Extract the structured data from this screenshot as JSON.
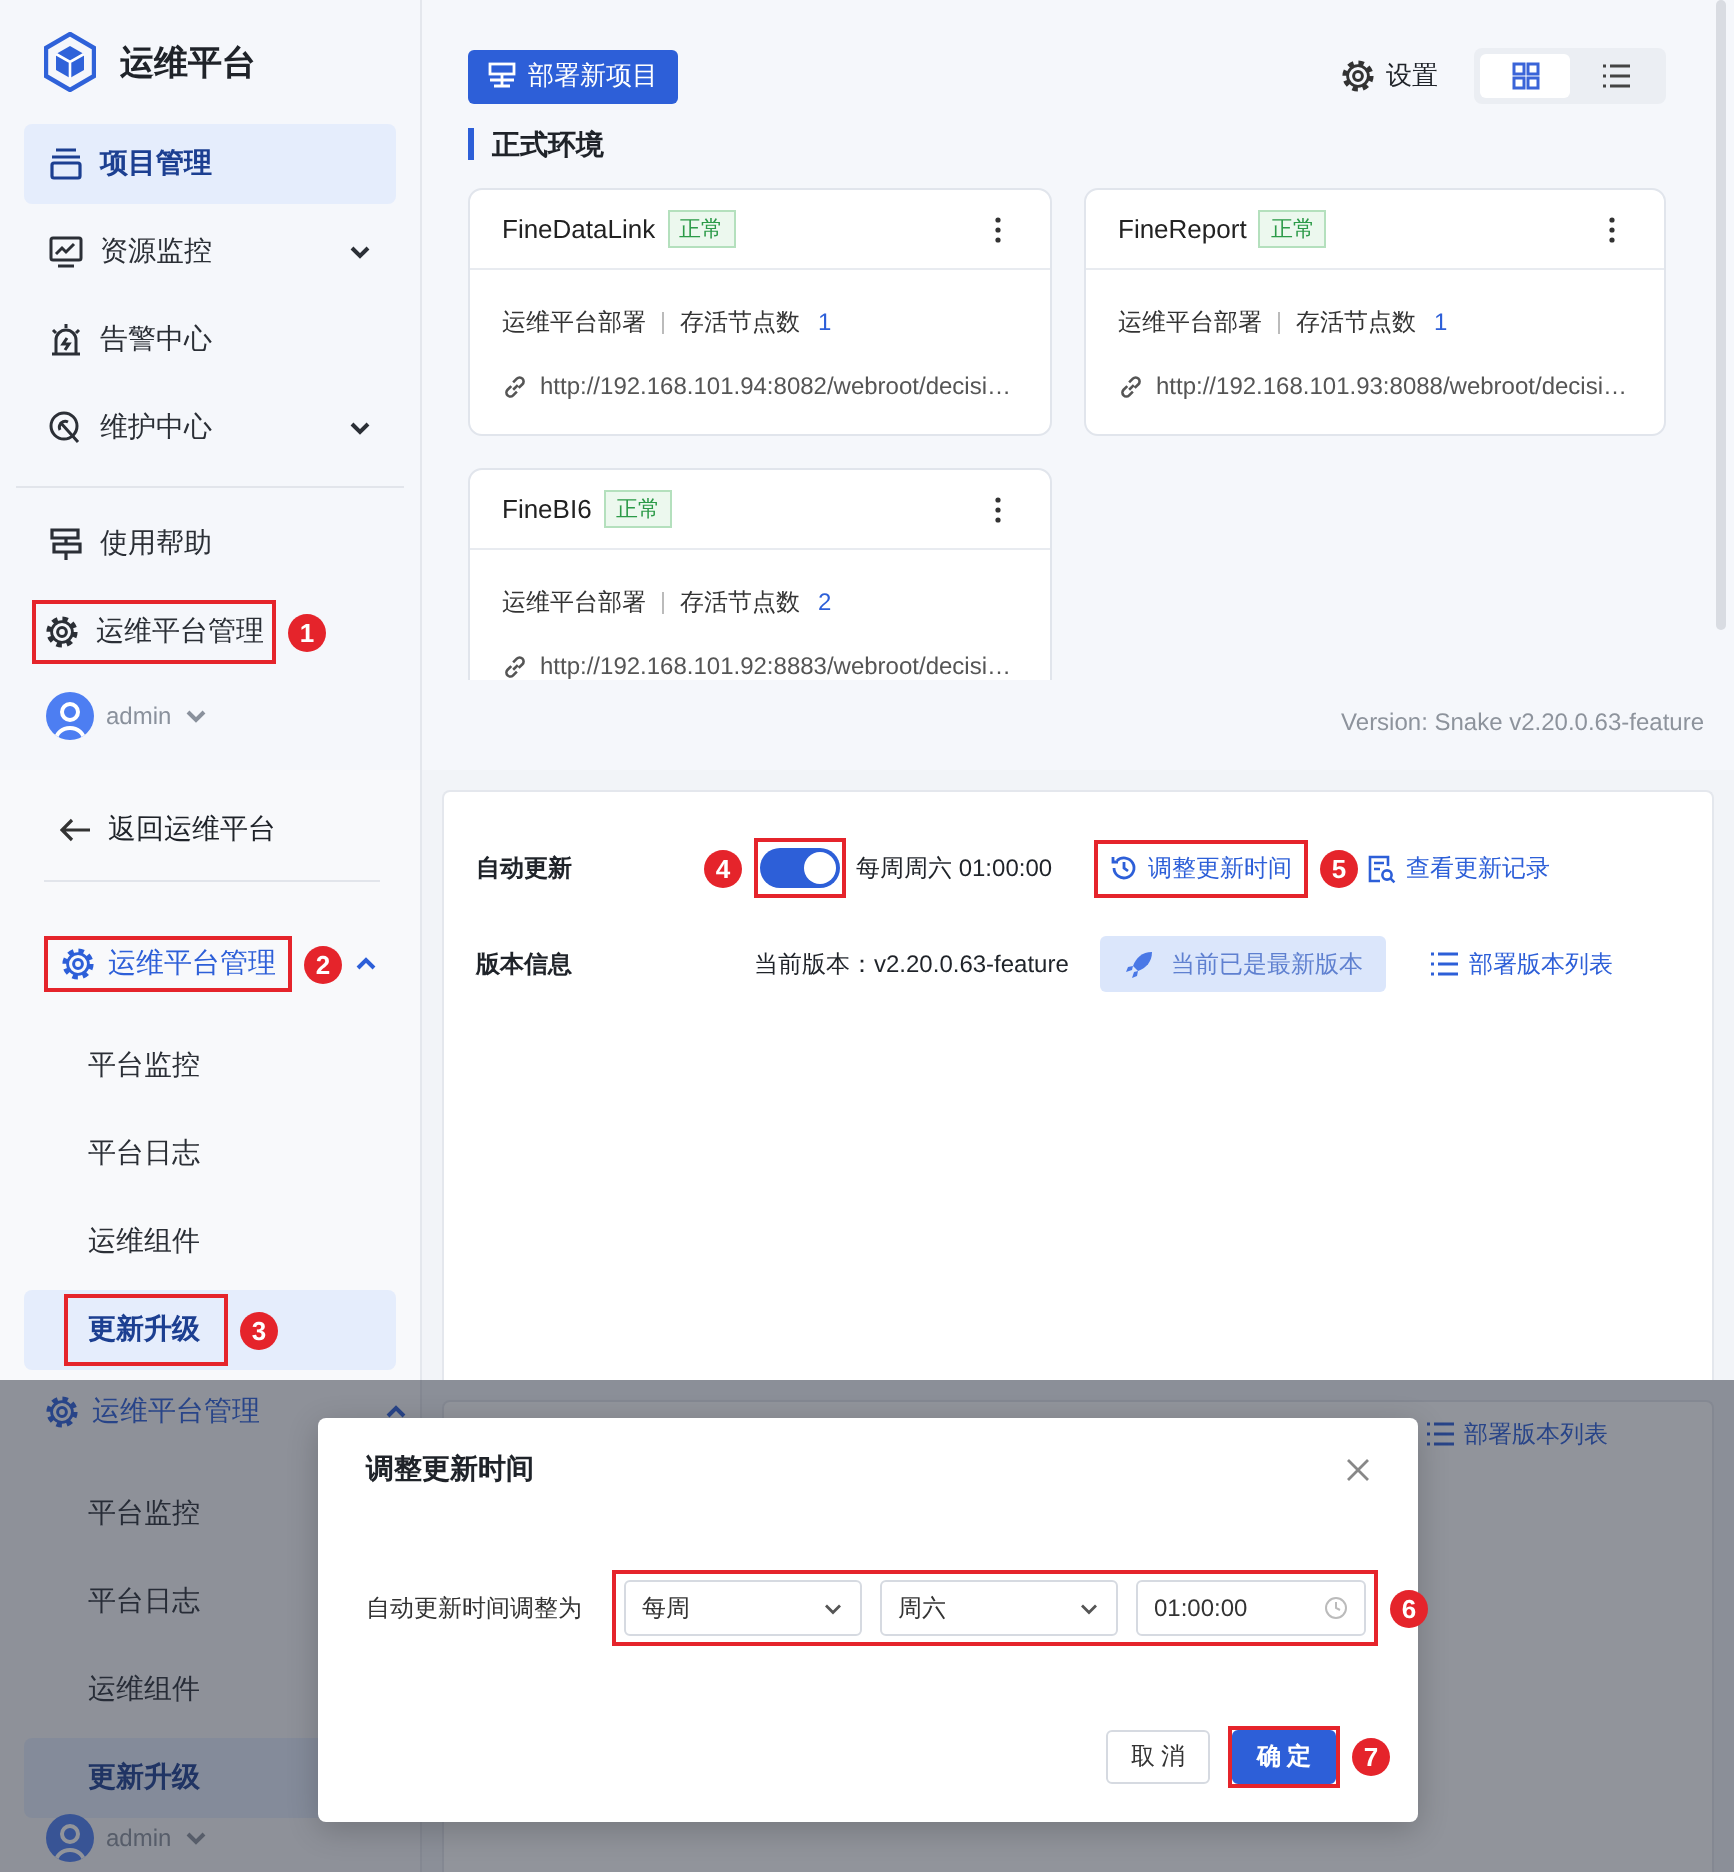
{
  "projects_view": {
    "app_title": "运维平台",
    "nav": [
      {
        "label": "项目管理",
        "selected": true,
        "expandable": false
      },
      {
        "label": "资源监控",
        "selected": false,
        "expandable": true
      },
      {
        "label": "告警中心",
        "selected": false,
        "expandable": false
      },
      {
        "label": "维护中心",
        "selected": false,
        "expandable": true
      }
    ],
    "bottom_nav": [
      {
        "label": "使用帮助",
        "selected": false
      },
      {
        "label": "运维平台管理",
        "selected": false,
        "callout": "1"
      }
    ],
    "user": "admin",
    "deploy_button": "部署新项目",
    "settings_label": "设置",
    "views": [
      {
        "kind": "grid",
        "selected": true
      },
      {
        "kind": "list",
        "selected": false
      }
    ],
    "section_title": "正式环境",
    "cards": [
      {
        "name": "FineDataLink",
        "status": "正常",
        "deploy": "运维平台部署",
        "nodes_label": "存活节点数",
        "nodes": "1",
        "url": "http://192.168.101.94:8082/webroot/decisi…"
      },
      {
        "name": "FineReport",
        "status": "正常",
        "deploy": "运维平台部署",
        "nodes_label": "存活节点数",
        "nodes": "1",
        "url": "http://192.168.101.93:8088/webroot/decisi…"
      },
      {
        "name": "FineBI6",
        "status": "正常",
        "deploy": "运维平台部署",
        "nodes_label": "存活节点数",
        "nodes": "2",
        "url": "http://192.168.101.92:8883/webroot/decisi…"
      }
    ],
    "version": "Version: Snake v2.20.0.63-feature"
  },
  "update_view": {
    "back_label": "返回运维平台",
    "group": {
      "label": "运维平台管理",
      "expanded": true,
      "callout": "2"
    },
    "sub_items": [
      {
        "label": "平台监控",
        "selected": false
      },
      {
        "label": "平台日志",
        "selected": false
      },
      {
        "label": "运维组件",
        "selected": false
      },
      {
        "label": "更新升级",
        "selected": true,
        "callout": "3"
      }
    ],
    "auto_update": {
      "label": "自动更新",
      "on": true,
      "toggle_callout": "4",
      "schedule": "每周周六 01:00:00",
      "adjust_link": "调整更新时间",
      "adjust_callout": "5",
      "history_link": "查看更新记录"
    },
    "version_info": {
      "label": "版本信息",
      "current": "当前版本：v2.20.0.63-feature",
      "latest_button": "当前已是最新版本",
      "latest_disabled": true,
      "list_link": "部署版本列表"
    }
  },
  "dialog_view": {
    "background": {
      "group": {
        "label": "运维平台管理",
        "expanded": true
      },
      "sub_items": [
        {
          "label": "平台监控",
          "selected": false
        },
        {
          "label": "平台日志",
          "selected": false
        },
        {
          "label": "运维组件",
          "selected": false
        },
        {
          "label": "更新升级",
          "selected": true
        }
      ],
      "user": "admin",
      "list_link": "部署版本列表"
    },
    "dialog": {
      "title": "调整更新时间",
      "field_label": "自动更新时间调整为",
      "fields_callout": "6",
      "fields": [
        {
          "kind": "select",
          "value": "每周"
        },
        {
          "kind": "select",
          "value": "周六"
        },
        {
          "kind": "time",
          "value": "01:00:00"
        }
      ],
      "cancel": "取消",
      "confirm": "确定",
      "confirm_callout": "7"
    }
  }
}
